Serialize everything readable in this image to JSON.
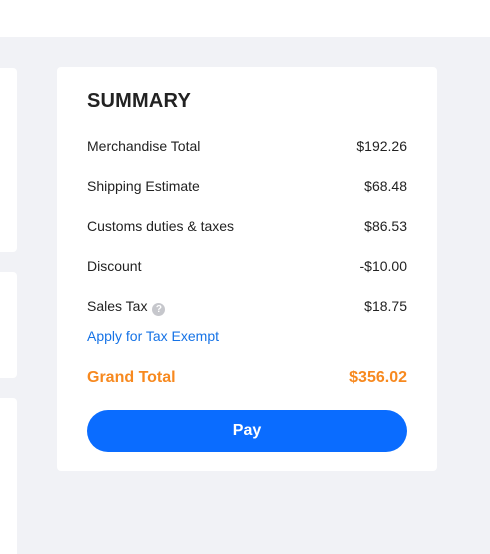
{
  "summary": {
    "title": "SUMMARY",
    "rows": [
      {
        "label": "Merchandise Total",
        "value": "$192.26"
      },
      {
        "label": "Shipping Estimate",
        "value": "$68.48"
      },
      {
        "label": "Customs duties & taxes",
        "value": "$86.53"
      },
      {
        "label": "Discount",
        "value": "-$10.00"
      },
      {
        "label": "Sales Tax",
        "value": "$18.75",
        "icon": "help-icon"
      }
    ],
    "tax_exempt_link": "Apply for Tax Exempt",
    "grand_total": {
      "label": "Grand Total",
      "value": "$356.02"
    },
    "pay_label": "Pay",
    "help_glyph": "?"
  },
  "colors": {
    "accent": "#f7891f",
    "primary_button": "#0a6cff",
    "link": "#1673e6",
    "page_background": "#f1f2f6"
  }
}
